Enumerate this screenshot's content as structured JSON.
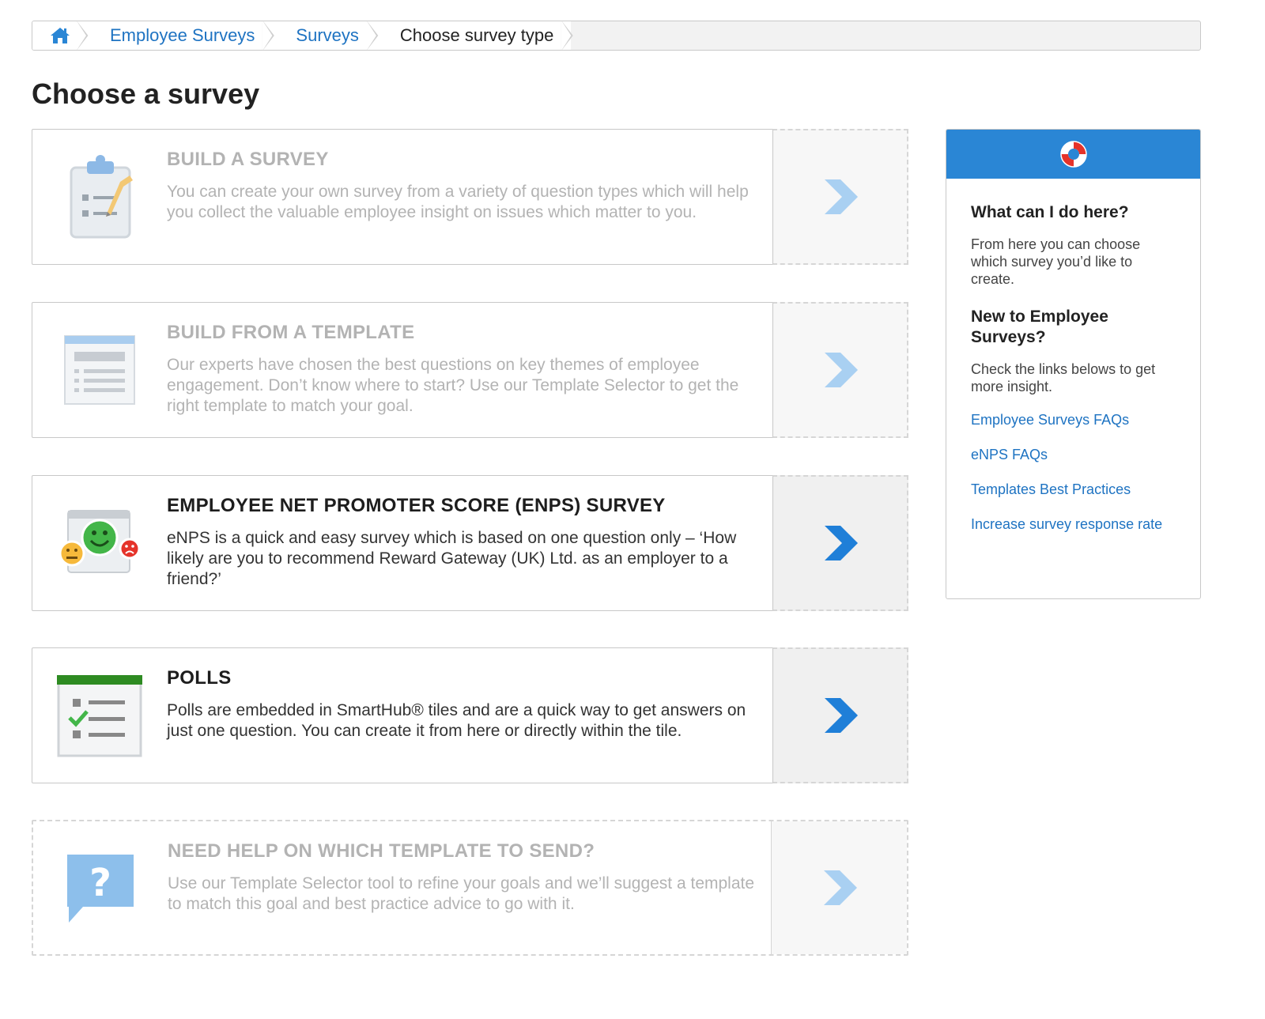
{
  "breadcrumb": {
    "home_icon": "home-icon",
    "items": [
      {
        "label": "Employee Surveys"
      },
      {
        "label": "Surveys"
      },
      {
        "label": "Choose survey type"
      }
    ]
  },
  "page": {
    "title": "Choose a survey"
  },
  "cards": [
    {
      "icon": "clipboard-icon",
      "title": "BUILD A SURVEY",
      "description": "You can create your own survey from a variety of question types which will help you collect the valuable employee insight on issues which matter to you.",
      "state": "disabled"
    },
    {
      "icon": "template-icon",
      "title": "BUILD FROM A TEMPLATE",
      "description": "Our experts have chosen the best questions on key themes of employee engagement. Don’t know where to start? Use our Template Selector to get the right template to match your goal.",
      "state": "disabled"
    },
    {
      "icon": "enps-faces-icon",
      "title": "EMPLOYEE NET PROMOTER SCORE (ENPS) SURVEY",
      "description": "eNPS is a quick and easy survey which is based on one question only – ‘How likely are you to recommend Reward Gateway (UK) Ltd. as an employer to a friend?’",
      "state": "enabled"
    },
    {
      "icon": "poll-checklist-icon",
      "title": "POLLS",
      "description": "Polls are embedded in SmartHub® tiles and are a quick way to get answers on just one question. You can create it from here or directly within the tile.",
      "state": "enabled"
    },
    {
      "icon": "question-bubble-icon",
      "title": "NEED HELP ON WHICH TEMPLATE TO SEND?",
      "description": "Use our Template Selector tool to refine your goals and we’ll suggest a template to match this goal and best practice advice to go with it.",
      "state": "disabled"
    }
  ],
  "help": {
    "header_icon": "lifebuoy-icon",
    "heading1": "What can I do here?",
    "text1": "From here you can choose which survey you’d like to create.",
    "heading2": "New to Employee Surveys?",
    "text2": "Check the links belows to get more insight.",
    "links": [
      {
        "label": "Employee Surveys FAQs"
      },
      {
        "label": "eNPS FAQs"
      },
      {
        "label": "Templates Best Practices"
      },
      {
        "label": "Increase survey response rate"
      }
    ]
  },
  "colors": {
    "link": "#1e73c2",
    "accent": "#2a86d5",
    "chevron_active": "#1f7fd8",
    "chevron_disabled": "#a9d0f2",
    "poll_bar": "#2e8b22"
  }
}
